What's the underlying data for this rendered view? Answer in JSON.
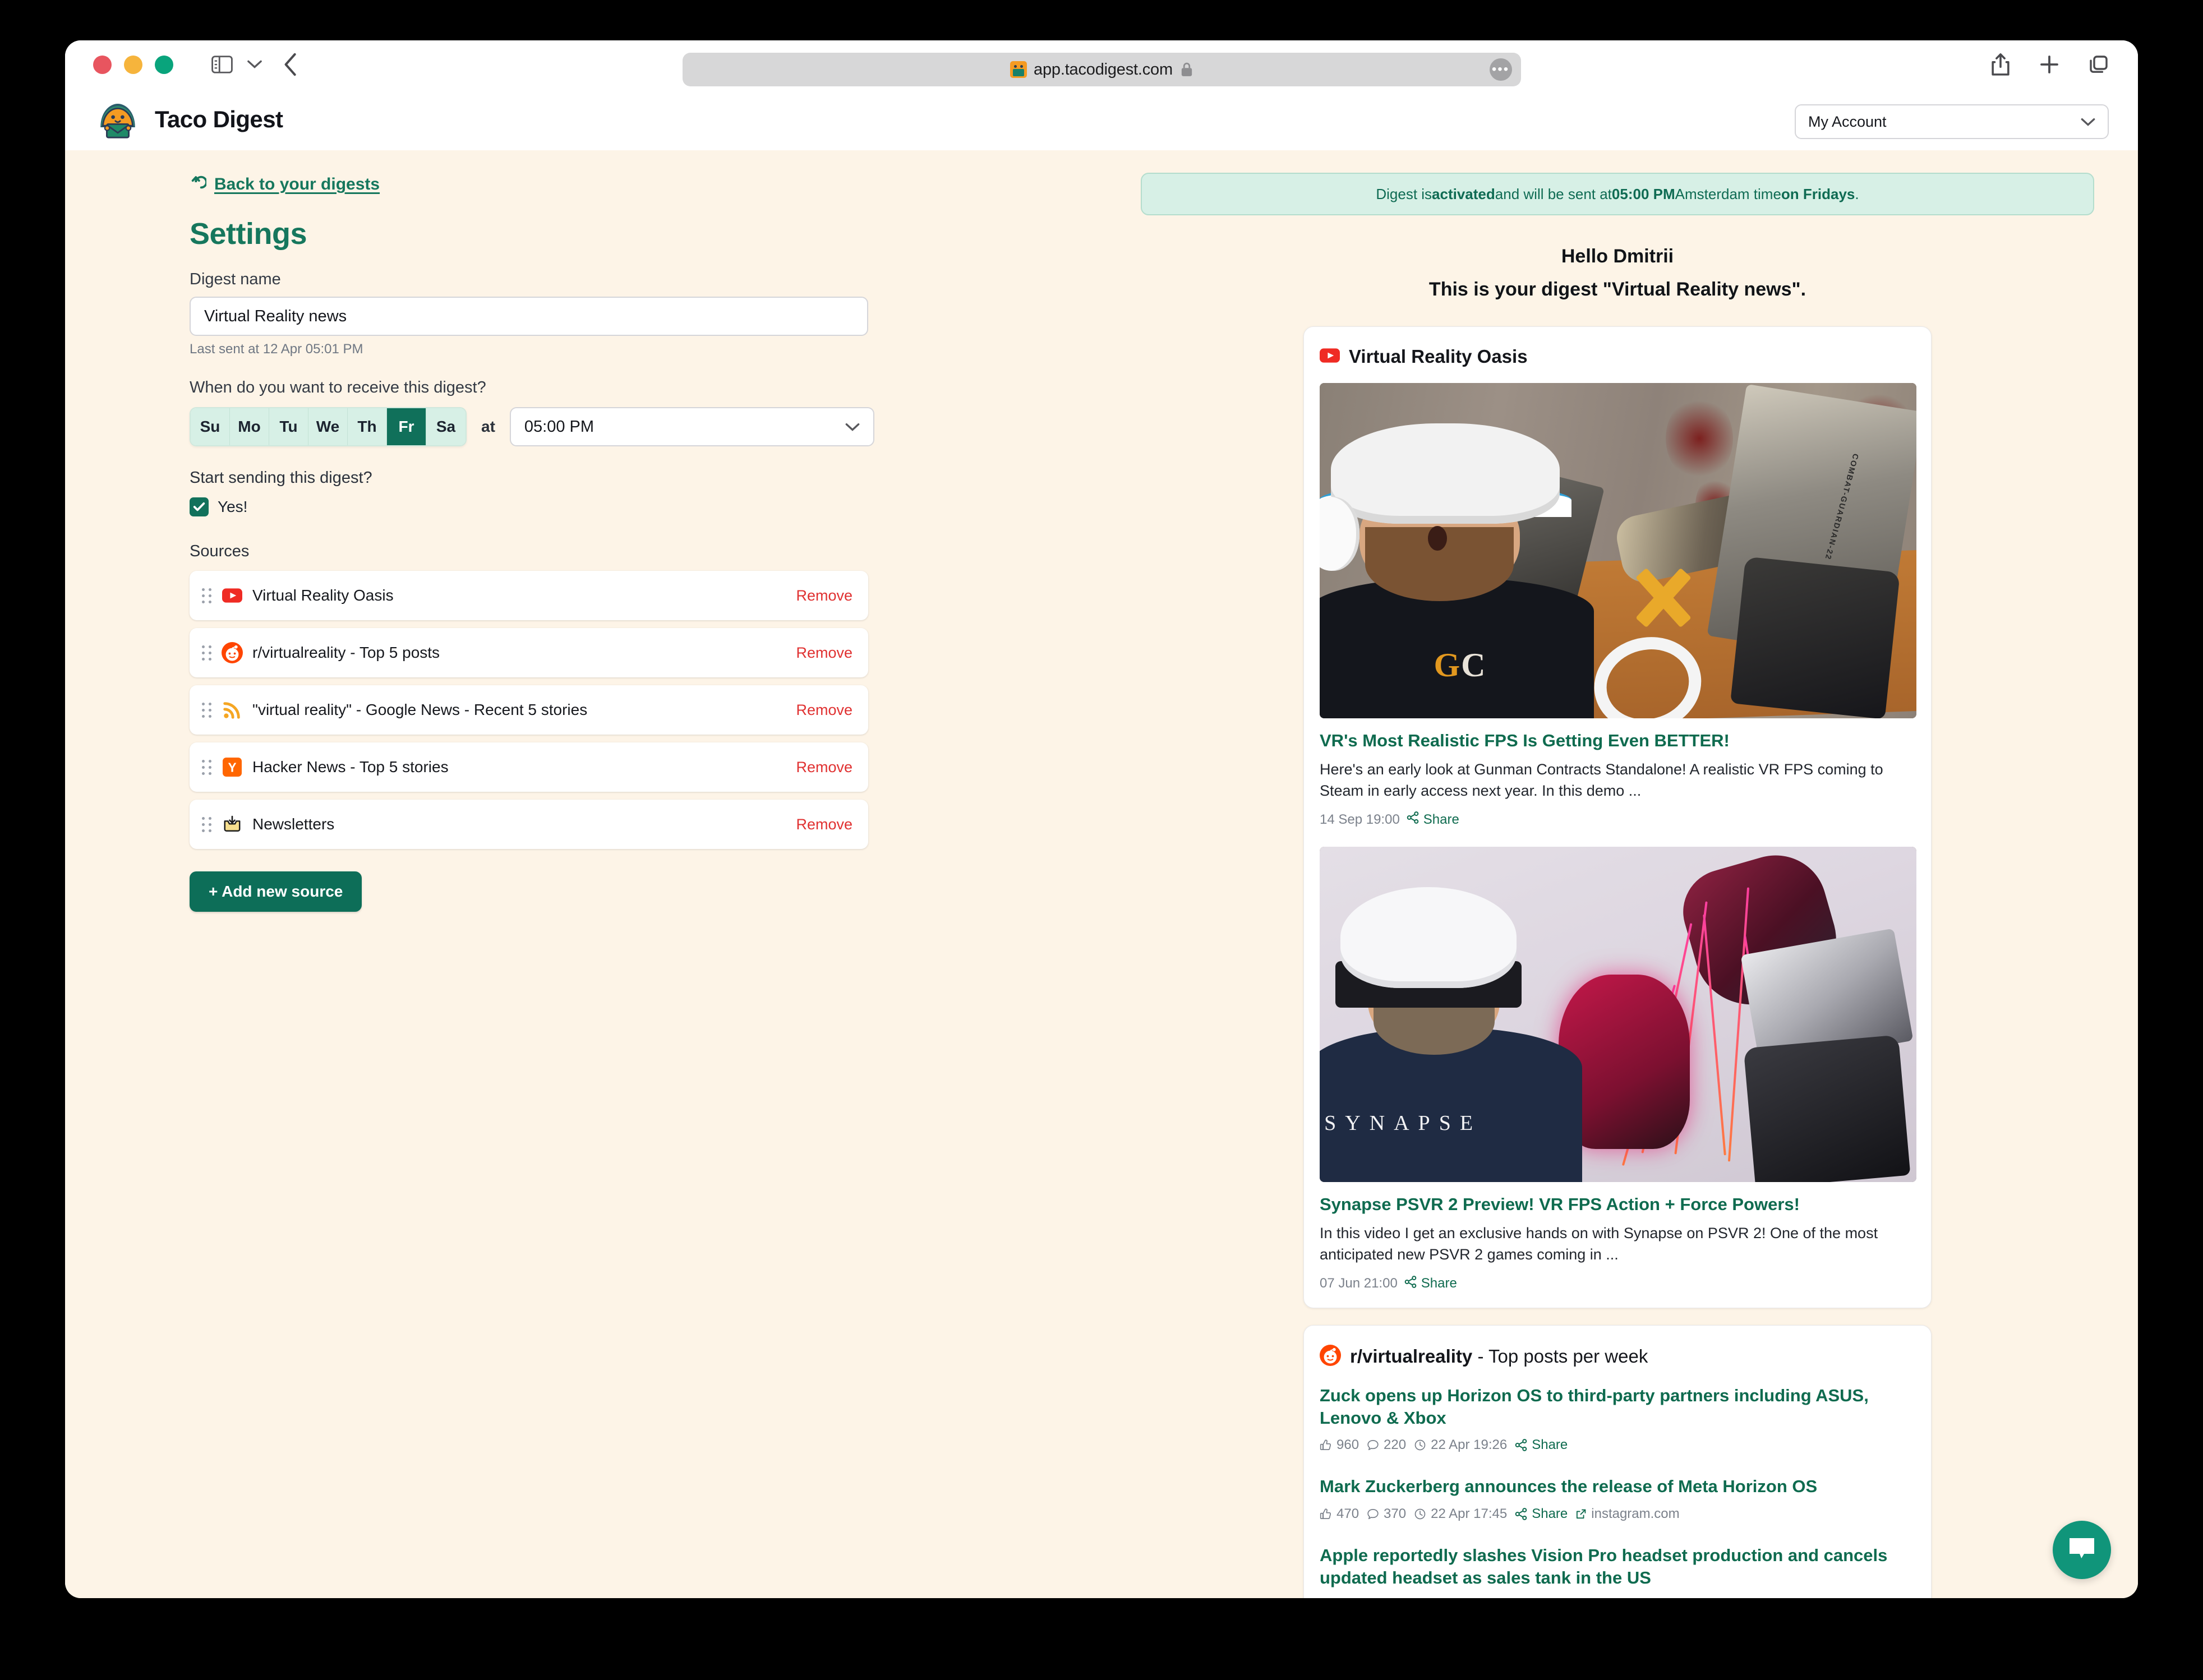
{
  "browser": {
    "url": "app.tacodigest.com",
    "traffic_lights": [
      "close",
      "minimize",
      "zoom"
    ]
  },
  "app_header": {
    "brand_name": "Taco Digest",
    "account_label": "My Account"
  },
  "settings": {
    "back_link": "Back to your digests",
    "title": "Settings",
    "digest_name_label": "Digest name",
    "digest_name_value": "Virtual Reality news",
    "last_sent": "Last sent at 12 Apr 05:01 PM",
    "when_label": "When do you want to receive this digest?",
    "days": [
      {
        "label": "Su",
        "active": false
      },
      {
        "label": "Mo",
        "active": false
      },
      {
        "label": "Tu",
        "active": false
      },
      {
        "label": "We",
        "active": false
      },
      {
        "label": "Th",
        "active": false
      },
      {
        "label": "Fr",
        "active": true
      },
      {
        "label": "Sa",
        "active": false
      }
    ],
    "at_word": "at",
    "time_value": "05:00 PM",
    "start_label": "Start sending this digest?",
    "yes_text": "Yes!",
    "yes_checked": true,
    "sources_label": "Sources",
    "sources": [
      {
        "name": "Virtual Reality Oasis",
        "icon": "youtube-icon",
        "remove": "Remove"
      },
      {
        "name": "r/virtualreality - Top 5 posts",
        "icon": "reddit-icon",
        "remove": "Remove"
      },
      {
        "name": "\"virtual reality\" - Google News - Recent 5 stories",
        "icon": "rss-icon",
        "remove": "Remove"
      },
      {
        "name": "Hacker News - Top 5 stories",
        "icon": "hackernews-icon",
        "remove": "Remove"
      },
      {
        "name": "Newsletters",
        "icon": "inbox-icon",
        "remove": "Remove"
      }
    ],
    "add_source_label": "+ Add new source"
  },
  "preview": {
    "banner": {
      "prefix": "Digest is ",
      "state": "activated",
      "mid": " and will be sent at ",
      "time": "05:00 PM",
      "tz": " Amsterdam time ",
      "day": "on Fridays",
      "suffix": "."
    },
    "greeting_line1": "Hello Dmitrii",
    "greeting_line2": "This is your digest \"Virtual Reality news\".",
    "youtube_card": {
      "channel": "Virtual Reality Oasis",
      "videos": [
        {
          "title": "VR's Most Realistic FPS Is Getting Even BETTER!",
          "desc": "Here's an early look at Gunman Contracts Standalone! A realistic VR FPS coming to Steam in early access next year. In this demo ...",
          "date": "14 Sep 19:00",
          "share": "Share",
          "thumb_alt": "man wearing white VR headset with in-game FPS pistol scene"
        },
        {
          "title": "Synapse PSVR 2 Preview! VR FPS Action + Force Powers!",
          "desc": "In this video I get an exclusive hands on with Synapse on PSVR 2! One of the most anticipated new PSVR 2 games coming in ...",
          "date": "07 Jun 21:00",
          "share": "Share",
          "thumb_alt": "man wearing PSVR2 headset with Synapse game force powers scene"
        }
      ]
    },
    "reddit_card": {
      "subreddit": "r/virtualreality",
      "suffix": " - Top posts per week",
      "posts": [
        {
          "title": "Zuck opens up Horizon OS to third-party partners including ASUS, Lenovo & Xbox",
          "upvotes": "960",
          "comments": "220",
          "date": "22 Apr 19:26",
          "share": "Share",
          "domain": ""
        },
        {
          "title": "Mark Zuckerberg announces the release of Meta Horizon OS",
          "upvotes": "470",
          "comments": "370",
          "date": "22 Apr 17:45",
          "share": "Share",
          "domain": "instagram.com"
        },
        {
          "title": "Apple reportedly slashes Vision Pro headset production and cancels updated headset as sales tank in the US",
          "upvotes": "",
          "comments": "",
          "date": "",
          "share": "",
          "domain": ""
        }
      ]
    }
  },
  "colors": {
    "brand_green": "#0d6e58",
    "link_green": "#0f6b4f",
    "page_bg": "#fdf4e7",
    "banner_bg": "#d7f0e6",
    "remove_red": "#e03131",
    "chat_green": "#10957a"
  }
}
